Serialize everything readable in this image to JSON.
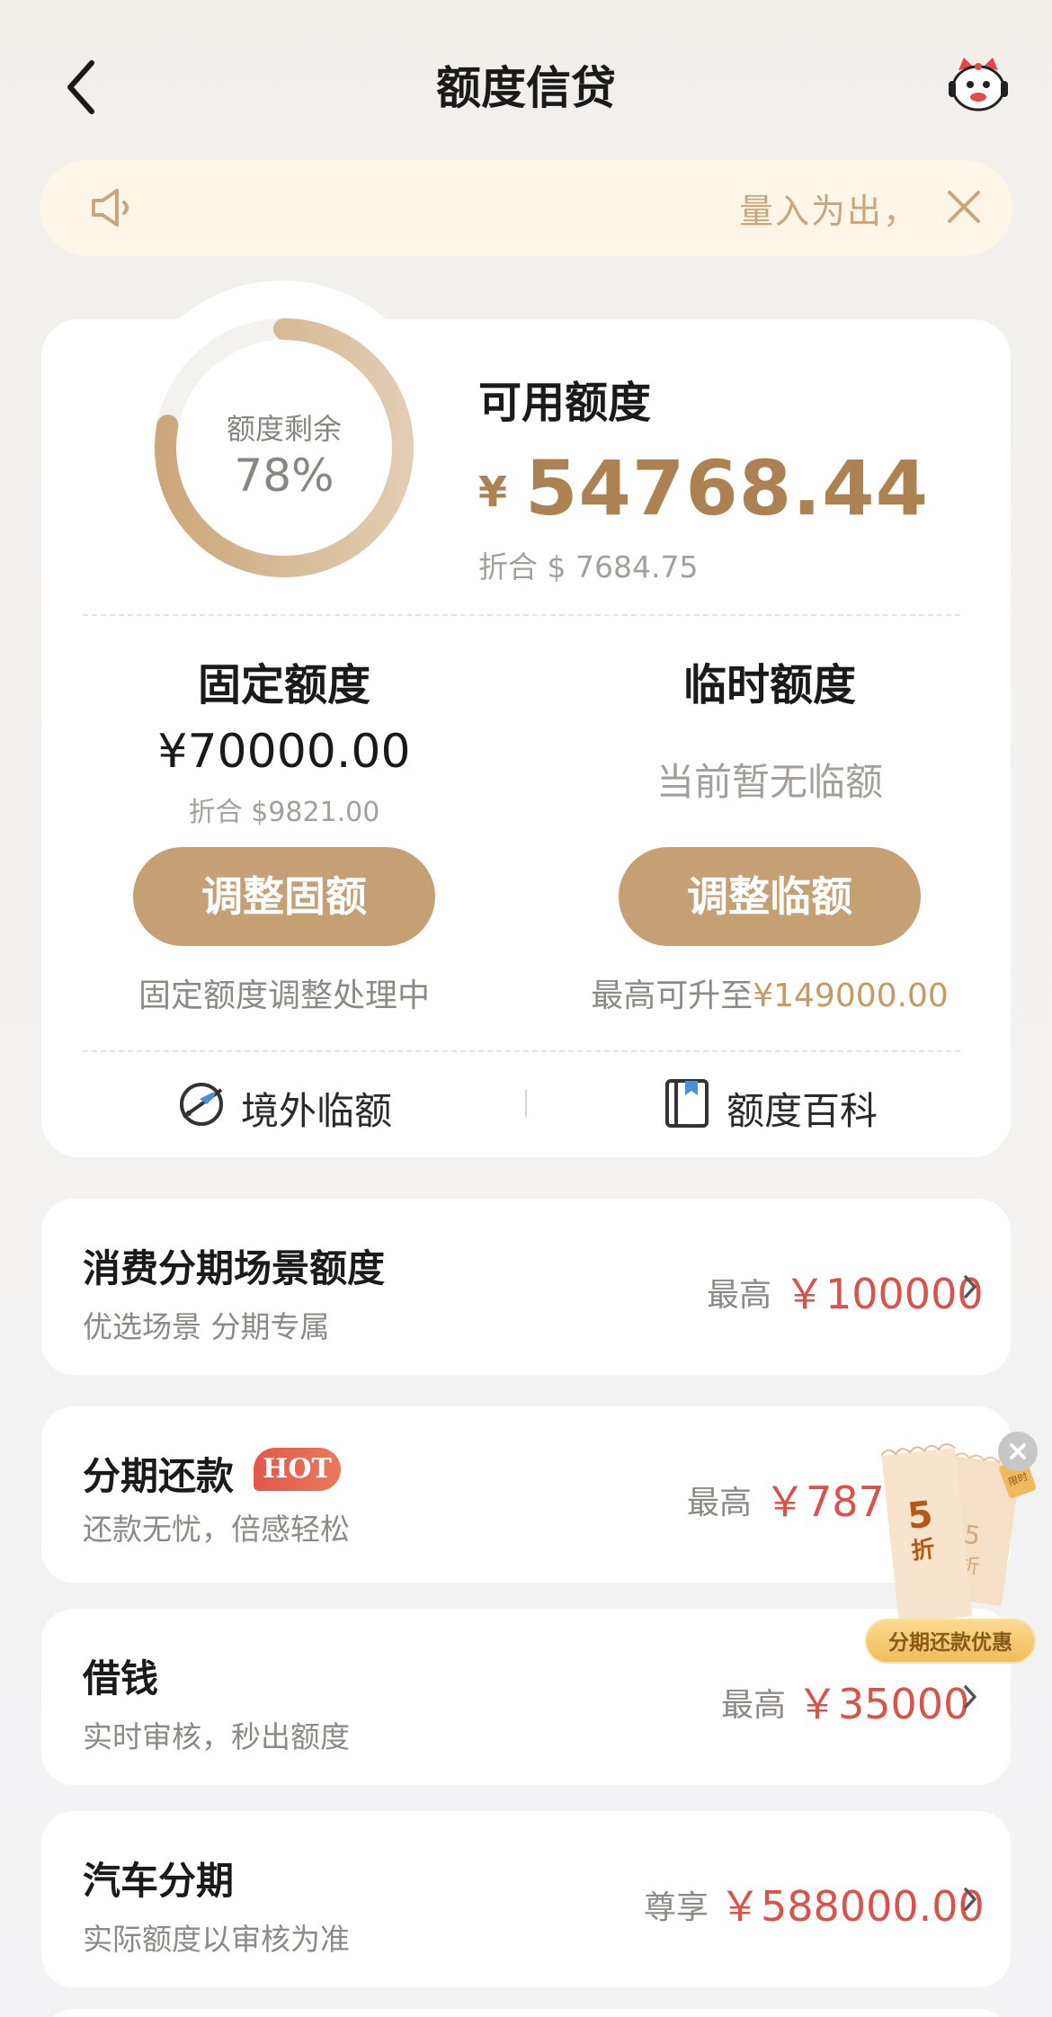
{
  "header": {
    "title": "额度信贷"
  },
  "notice": {
    "text": "量入为出，"
  },
  "quota": {
    "ring_label": "额度剩余",
    "ring_percent": "78%",
    "ring_fraction": 0.78,
    "available_title": "可用额度",
    "currency_symbol": "¥",
    "available_amount": "54768.44",
    "available_converted": "折合 $ 7684.75"
  },
  "fixed": {
    "title": "固定额度",
    "amount": "¥70000.00",
    "converted": "折合 $9821.00",
    "button": "调整固额",
    "hint": "固定额度调整处理中"
  },
  "temporary": {
    "title": "临时额度",
    "status": "当前暂无临额",
    "button": "调整临额",
    "hint_prefix": "最高可升至",
    "hint_value": "¥149000.00"
  },
  "links": {
    "overseas": "境外临额",
    "encyclopedia": "额度百科"
  },
  "products": [
    {
      "title": "消费分期场景额度",
      "subtitle": "优选场景 分期专属",
      "label": "最高",
      "value": "￥100000"
    },
    {
      "title": "分期还款",
      "badge": "HOT",
      "subtitle": "还款无忧，倍感轻松",
      "label": "最高",
      "value": "￥7871.00"
    },
    {
      "title": "借钱",
      "subtitle": "实时审核，秒出额度",
      "label": "最高",
      "value": "￥35000"
    },
    {
      "title": "汽车分期",
      "subtitle": "实际额度以审核为准",
      "label": "尊享",
      "value": "￥588000.00"
    }
  ],
  "promo": {
    "discount": "5",
    "unit": "折",
    "tag": "限时",
    "label": "分期还款优惠"
  },
  "colors": {
    "accent_gold": "#c6a075",
    "amount_gold": "#ad8252",
    "value_red": "#d9534a",
    "notice_bg": "#fdf5e6"
  }
}
